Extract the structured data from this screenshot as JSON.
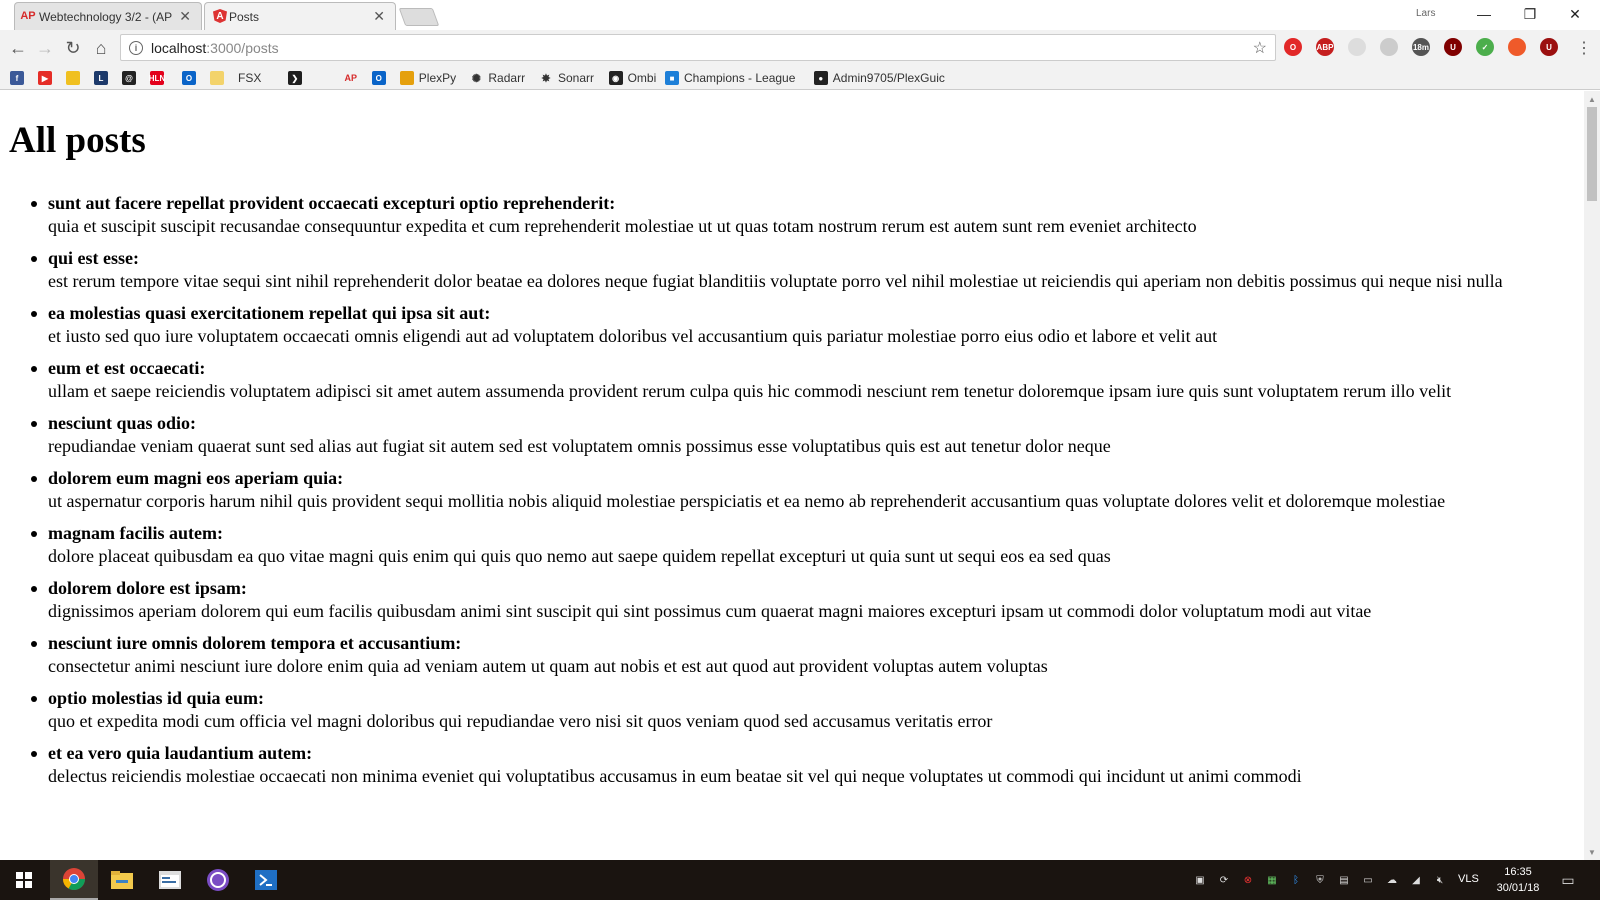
{
  "tabs": [
    {
      "title": "Webtechnology 3/2 - (AP",
      "close": "✕"
    },
    {
      "title": "Posts",
      "close": "✕"
    }
  ],
  "profile": "Lars",
  "window_controls": {
    "minimize": "—",
    "restore": "❐",
    "close": "✕"
  },
  "nav": {
    "back": "←",
    "forward": "→",
    "reload": "↻",
    "home": "⌂"
  },
  "address": {
    "host": "localhost",
    "path": ":3000/posts",
    "star": "☆"
  },
  "extensions": [
    {
      "name": "opera-icon",
      "label": "O",
      "color": "#e22828"
    },
    {
      "name": "adblock-plus-icon",
      "label": "ABP",
      "color": "#c51f1f"
    },
    {
      "name": "circle-ext-icon",
      "label": "",
      "color": "#dddddd"
    },
    {
      "name": "feather-ext-icon",
      "label": "",
      "color": "#cccccc"
    },
    {
      "name": "timer-ext-icon",
      "label": "18m",
      "color": "#555555"
    },
    {
      "name": "ublock-icon",
      "label": "U",
      "color": "#800000"
    },
    {
      "name": "shield-check-icon",
      "label": "✓",
      "color": "#4cae4c"
    },
    {
      "name": "orange-ext-icon",
      "label": "",
      "color": "#ef5a2a"
    },
    {
      "name": "u-ext-icon",
      "label": "U",
      "color": "#9b1010"
    }
  ],
  "bookmarks": [
    {
      "name": "facebook",
      "label": "",
      "color": "#3b5998",
      "glyph": "f"
    },
    {
      "name": "youtube",
      "label": "",
      "color": "#e52d27",
      "glyph": "▶"
    },
    {
      "name": "yellow-site",
      "label": "",
      "color": "#f0c020",
      "glyph": ""
    },
    {
      "name": "l-site",
      "label": "",
      "color": "#1d3a6b",
      "glyph": "L"
    },
    {
      "name": "spiral-site",
      "label": "",
      "color": "#222222",
      "glyph": "@"
    },
    {
      "name": "hln",
      "label": "",
      "color": "#e3001b",
      "glyph": "HLN"
    },
    {
      "name": "outlook-1",
      "label": "",
      "color": "#0a64c8",
      "glyph": "O"
    },
    {
      "name": "folder",
      "label": "",
      "color": "#f3d36b",
      "glyph": ""
    },
    {
      "name": "fsx",
      "label": "FSX",
      "color": "",
      "glyph": ""
    },
    {
      "name": "plex-arrow",
      "label": "",
      "color": "#1f1f1f",
      "glyph": "❯"
    },
    {
      "name": "apple",
      "label": "",
      "color": "",
      "glyph": ""
    },
    {
      "name": "ap",
      "label": "",
      "color": "",
      "glyph": "AP"
    },
    {
      "name": "outlook-2",
      "label": "",
      "color": "#0a64c8",
      "glyph": "O"
    },
    {
      "name": "plexpy",
      "label": "PlexPy",
      "color": "#e5a00d",
      "glyph": ""
    },
    {
      "name": "radarr",
      "label": "Radarr",
      "color": "",
      "glyph": "✺"
    },
    {
      "name": "sonarr",
      "label": "Sonarr",
      "color": "",
      "glyph": "✸"
    },
    {
      "name": "ombi",
      "label": "Ombi",
      "color": "#222222",
      "glyph": "◉"
    },
    {
      "name": "champions-league",
      "label": "Champions - League",
      "color": "#1d7fd8",
      "glyph": "■"
    },
    {
      "name": "github",
      "label": "Admin9705/PlexGuic",
      "color": "#222222",
      "glyph": "●"
    }
  ],
  "page": {
    "heading": "All posts",
    "posts": [
      {
        "title": "sunt aut facere repellat provident occaecati excepturi optio reprehenderit:",
        "body": "quia et suscipit suscipit recusandae consequuntur expedita et cum reprehenderit molestiae ut ut quas totam nostrum rerum est autem sunt rem eveniet architecto"
      },
      {
        "title": "qui est esse:",
        "body": "est rerum tempore vitae sequi sint nihil reprehenderit dolor beatae ea dolores neque fugiat blanditiis voluptate porro vel nihil molestiae ut reiciendis qui aperiam non debitis possimus qui neque nisi nulla"
      },
      {
        "title": "ea molestias quasi exercitationem repellat qui ipsa sit aut:",
        "body": "et iusto sed quo iure voluptatem occaecati omnis eligendi aut ad voluptatem doloribus vel accusantium quis pariatur molestiae porro eius odio et labore et velit aut"
      },
      {
        "title": "eum et est occaecati:",
        "body": "ullam et saepe reiciendis voluptatem adipisci sit amet autem assumenda provident rerum culpa quis hic commodi nesciunt rem tenetur doloremque ipsam iure quis sunt voluptatem rerum illo velit"
      },
      {
        "title": "nesciunt quas odio:",
        "body": "repudiandae veniam quaerat sunt sed alias aut fugiat sit autem sed est voluptatem omnis possimus esse voluptatibus quis est aut tenetur dolor neque"
      },
      {
        "title": "dolorem eum magni eos aperiam quia:",
        "body": "ut aspernatur corporis harum nihil quis provident sequi mollitia nobis aliquid molestiae perspiciatis et ea nemo ab reprehenderit accusantium quas voluptate dolores velit et doloremque molestiae"
      },
      {
        "title": "magnam facilis autem:",
        "body": "dolore placeat quibusdam ea quo vitae magni quis enim qui quis quo nemo aut saepe quidem repellat excepturi ut quia sunt ut sequi eos ea sed quas"
      },
      {
        "title": "dolorem dolore est ipsam:",
        "body": "dignissimos aperiam dolorem qui eum facilis quibusdam animi sint suscipit qui sint possimus cum quaerat magni maiores excepturi ipsam ut commodi dolor voluptatum modi aut vitae"
      },
      {
        "title": "nesciunt iure omnis dolorem tempora et accusantium:",
        "body": "consectetur animi nesciunt iure dolore enim quia ad veniam autem ut quam aut nobis et est aut quod aut provident voluptas autem voluptas"
      },
      {
        "title": "optio molestias id quia eum:",
        "body": "quo et expedita modi cum officia vel magni doloribus qui repudiandae vero nisi sit quos veniam quod sed accusamus veritatis error"
      },
      {
        "title": "et ea vero quia laudantium autem:",
        "body": "delectus reiciendis molestiae occaecati non minima eveniet qui voluptatibus accusamus in eum beatae sit vel qui neque voluptates ut commodi qui incidunt ut animi commodi"
      }
    ]
  },
  "taskbar": {
    "apps": [
      {
        "name": "chrome-taskbar-icon",
        "active": true
      },
      {
        "name": "file-explorer-taskbar-icon",
        "active": false
      },
      {
        "name": "app-window-taskbar-icon",
        "active": false
      },
      {
        "name": "visual-studio-taskbar-icon",
        "active": false
      },
      {
        "name": "powershell-taskbar-icon",
        "active": false
      }
    ],
    "language": "VLS",
    "time": "16:35",
    "date": "30/01/18"
  }
}
